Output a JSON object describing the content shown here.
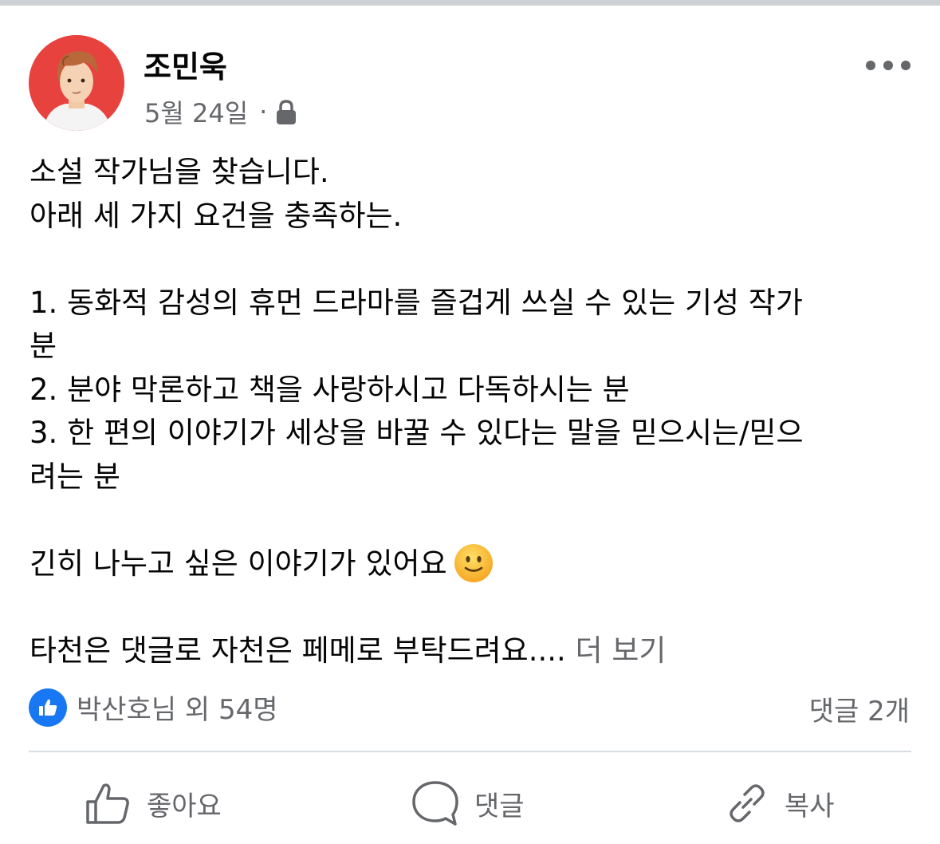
{
  "post": {
    "author": "조민욱",
    "date": "5월 24일",
    "separator": "·",
    "privacy_icon": "lock-icon",
    "more_icon": "more-horizontal-icon",
    "body_lines": [
      "소설 작가님을 찾습니다.",
      "아래 세 가지 요건을 충족하는.",
      "",
      "1. 동화적 감성의 휴먼 드라마를 즐겁게 쓰실 수 있는 기성 작가",
      "분",
      "2. 분야 막론하고 책을 사랑하시고 다독하시는 분",
      "3. 한 편의 이야기가 세상을 바꿀 수 있다는 말을 믿으시는/믿으",
      "려는 분",
      "",
      "긴히 나누고 싶은 이야기가 있어요",
      "",
      "타천은 댓글로 자천은 페메로 부탁드려요...."
    ],
    "emoji": "slightly-smiling-face-icon",
    "see_more": "더 보기"
  },
  "reactions": {
    "icon": "like-badge-icon",
    "summary": "박산호님 외 54명",
    "comments": "댓글 2개"
  },
  "actions": {
    "like": "좋아요",
    "comment": "댓글",
    "share": "복사"
  }
}
